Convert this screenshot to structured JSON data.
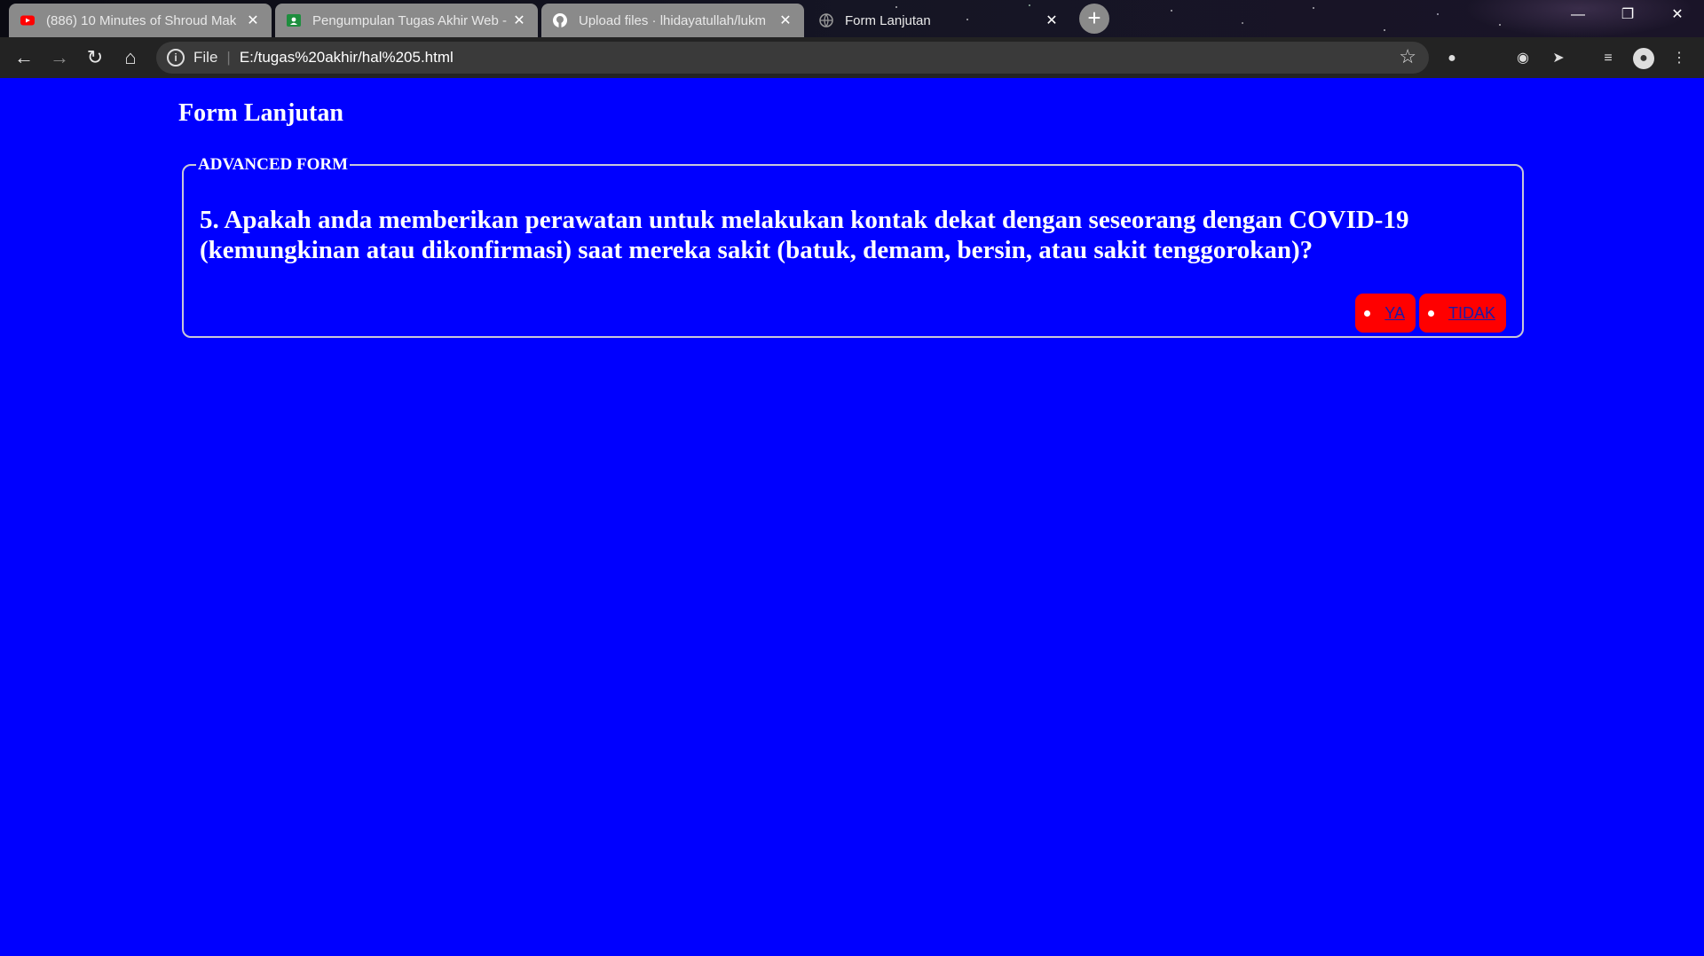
{
  "browser": {
    "tabs": [
      {
        "title": "(886) 10 Minutes of Shroud Mak",
        "favicon": "youtube-icon",
        "active": false
      },
      {
        "title": "Pengumpulan Tugas Akhir Web -",
        "favicon": "google-classroom-icon",
        "active": false
      },
      {
        "title": "Upload files · lhidayatullah/lukm",
        "favicon": "github-icon",
        "active": false
      },
      {
        "title": "Form Lanjutan",
        "favicon": "globe-icon",
        "active": true
      }
    ],
    "address": {
      "scheme": "File",
      "url": "E:/tugas%20akhir/hal%205.html"
    }
  },
  "page": {
    "title": "Form Lanjutan",
    "legend": "ADVANCED FORM",
    "question": "5. Apakah anda memberikan perawatan untuk melakukan kontak dekat dengan seseorang dengan COVID-19 (kemungkinan atau dikonfirmasi) saat mereka sakit (batuk, demam, bersin, atau sakit tenggorokan)?",
    "answers": {
      "yes": "YA",
      "no": "TIDAK"
    }
  },
  "colors": {
    "page_background": "#0000ff",
    "answer_background": "#ff0000",
    "link": "#1a1aa8"
  }
}
